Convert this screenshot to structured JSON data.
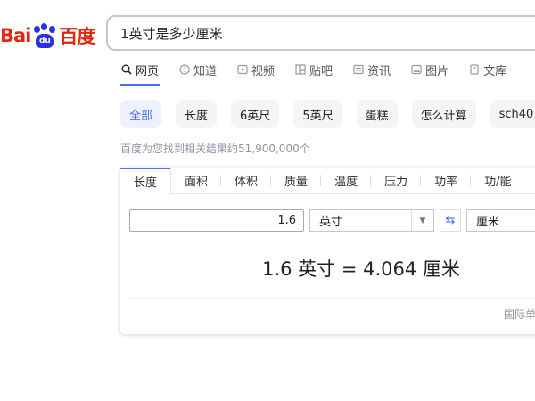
{
  "logo": {
    "left": "Bai",
    "pad": "du",
    "right": "百度"
  },
  "search": {
    "query": "1英寸是多少厘米"
  },
  "nav": [
    {
      "label": "网页",
      "icon": "search-icon"
    },
    {
      "label": "知道",
      "icon": "question-icon"
    },
    {
      "label": "视频",
      "icon": "video-icon"
    },
    {
      "label": "贴吧",
      "icon": "tieba-icon"
    },
    {
      "label": "资讯",
      "icon": "news-icon"
    },
    {
      "label": "图片",
      "icon": "image-icon"
    },
    {
      "label": "文库",
      "icon": "doc-icon"
    }
  ],
  "chips": [
    "全部",
    "长度",
    "6英尺",
    "5英尺",
    "蛋糕",
    "怎么计算",
    "sch40"
  ],
  "result_count": "百度为您找到相关结果约51,900,000个",
  "converter": {
    "categories": [
      "长度",
      "面积",
      "体积",
      "质量",
      "温度",
      "压力",
      "功率",
      "功/能"
    ],
    "value": "1.6",
    "from_unit": "英寸",
    "to_unit": "厘米",
    "result": "1.6 英寸 = 4.064 厘米",
    "standard_label": "国际单位"
  },
  "colors": {
    "accent": "#4e6ef2",
    "logo_red": "#de2910",
    "logo_blue": "#2932e1"
  }
}
